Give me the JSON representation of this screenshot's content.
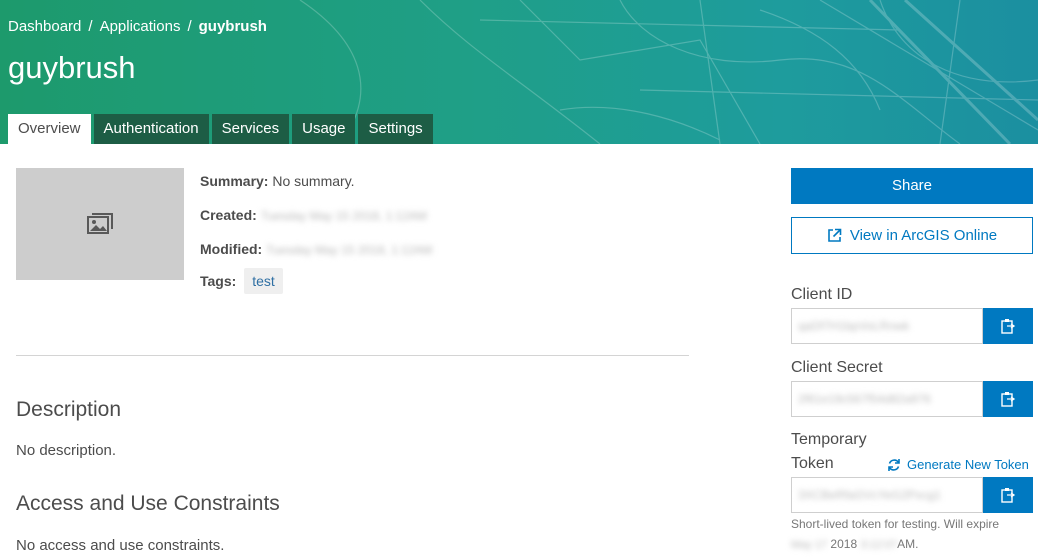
{
  "breadcrumb": {
    "items": [
      "Dashboard",
      "Applications"
    ],
    "separator": "/",
    "current": "guybrush"
  },
  "page": {
    "title": "guybrush"
  },
  "tabs": [
    {
      "label": "Overview",
      "active": true
    },
    {
      "label": "Authentication",
      "active": false
    },
    {
      "label": "Services",
      "active": false
    },
    {
      "label": "Usage",
      "active": false
    },
    {
      "label": "Settings",
      "active": false
    }
  ],
  "overview": {
    "thumbnail_icon": "image-icon",
    "summary_label": "Summary:",
    "summary_value": "No summary.",
    "created_label": "Created:",
    "created_value": "Tuesday May 15 2018, 1:12AM",
    "modified_label": "Modified:",
    "modified_value": "Tuesday May 15 2018, 1:12AM",
    "tags_label": "Tags:",
    "tags": [
      "test"
    ]
  },
  "description": {
    "title": "Description",
    "text": "No description."
  },
  "constraints": {
    "title": "Access and Use Constraints",
    "text": "No access and use constraints."
  },
  "actions": {
    "share_label": "Share",
    "view_arcgis_label": "View in ArcGIS Online",
    "view_arcgis_icon": "external-link-icon"
  },
  "credentials": {
    "client_id_label": "Client ID",
    "client_id_value": "qaDf7H1bpVoLRnwk",
    "client_secret_label": "Client Secret",
    "client_secret_value": "2f61e19c567f54d82a976",
    "token_label_line1": "Temporary",
    "token_label_line2": "Token",
    "token_value": "3XCBeRfaGVcYeG2Pxcg1",
    "generate_token_label": "Generate New Token",
    "generate_token_icon": "refresh-icon",
    "copy_icon": "clipboard-icon",
    "hint_text": "Short-lived token for testing. Will expire",
    "hint_date_blurred": "May 17",
    "hint_year": "2018",
    "hint_time_blurred": "3:12:07",
    "hint_ampm": "AM."
  },
  "colors": {
    "brand_blue": "#0079c1",
    "header_green": "#1f9f87",
    "tab_dark": "#1d5d45"
  }
}
